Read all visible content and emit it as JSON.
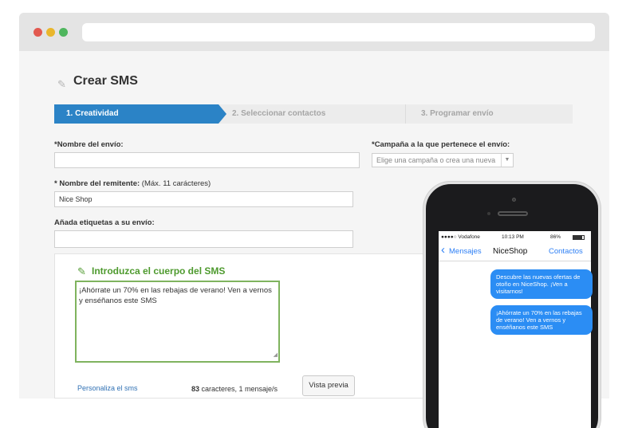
{
  "page": {
    "title": "Crear SMS"
  },
  "steps": [
    {
      "label": "1. Creatividad"
    },
    {
      "label": "2. Seleccionar contactos"
    },
    {
      "label": "3. Programar envío"
    }
  ],
  "form": {
    "name_label": "*Nombre del envío:",
    "name_value": "",
    "campaign_label": "*Campaña a la que pertenece el envío:",
    "campaign_placeholder": "Elige una campaña o crea una nueva",
    "sender_label": "* Nombre del remitente:",
    "sender_hint": " (Máx. 11 carácteres)",
    "sender_value": "Nice Shop",
    "tags_label": "Añada etiquetas a su envío:",
    "tags_value": ""
  },
  "sms": {
    "heading": "Introduzca el cuerpo del SMS",
    "body": "¡Ahórrate un 70% en las rebajas de verano! Ven a vernos y enséñanos este SMS",
    "personalize_link": "Personaliza el sms",
    "char_count": "83",
    "count_text": " caracteres, 1 mensaje/s",
    "preview_button": "Vista previa"
  },
  "phone": {
    "carrier": "●●●●○ Vodafone",
    "time": "10:13 PM",
    "battery_text": "86%",
    "battery_level": 0.86,
    "back_label": "Mensajes",
    "contact_name": "NiceShop",
    "contacts_label": "Contactos",
    "messages": [
      {
        "text": "Descubre las nuevas ofertas de otoño en NiceShop. ¡Ven a visitarnos!"
      },
      {
        "text": "¡Ahórrate un 70% en las rebajas de verano! Ven a vernos y enséñanos este SMS"
      }
    ]
  },
  "icons": {
    "title_icon": "pencil-icon",
    "sms_icon": "edit-icon"
  },
  "colors": {
    "step_active": "#2b83c6",
    "sms_heading": "#4e9a2e",
    "bubble": "#2b8df4",
    "link": "#3071b4"
  }
}
